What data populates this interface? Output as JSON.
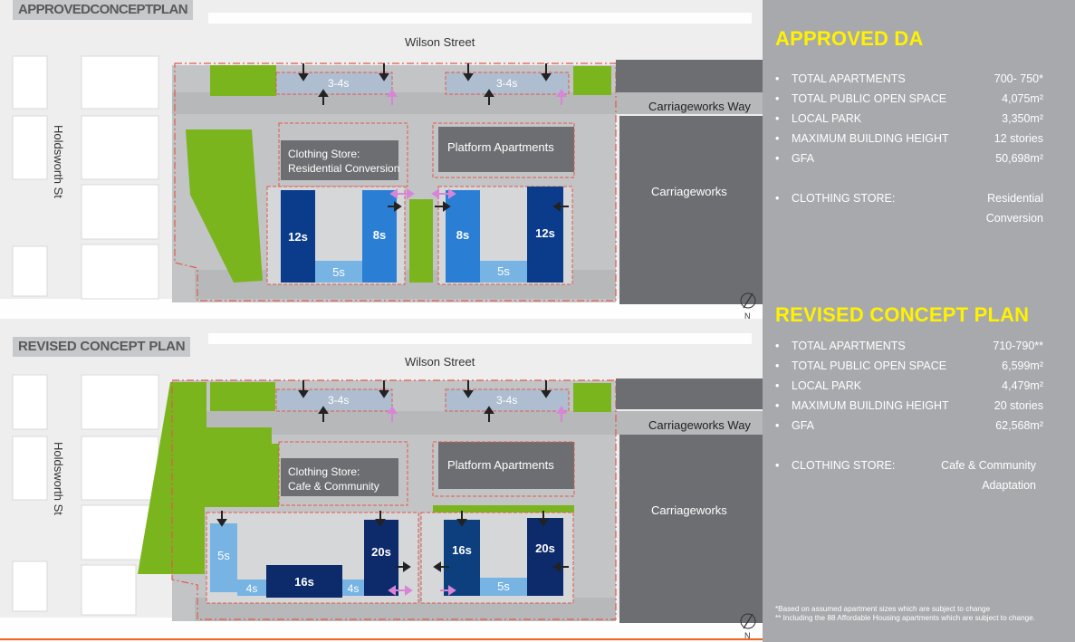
{
  "top_plan": {
    "header": "APPROVEDCONCEPTPLAN",
    "streets": {
      "north": "Wilson Street",
      "west": "Holdsworth St",
      "east_road": "Carriageworks Way",
      "east_block": "Carriageworks"
    },
    "labels": {
      "north_left": "3-4s",
      "north_right": "3-4s",
      "clothing_store_line1": "Clothing Store:",
      "clothing_store_line2": "Residential Conversion",
      "platform": "Platform Apartments",
      "b1": "12s",
      "b2": "5s",
      "b3": "8s",
      "b4": "8s",
      "b5": "5s",
      "b6": "12s"
    },
    "north_mark": "N"
  },
  "bottom_plan": {
    "header": "REVISED CONCEPT PLAN",
    "streets": {
      "north": "Wilson Street",
      "west": "Holdsworth St",
      "east_road": "Carriageworks Way",
      "east_block": "Carriageworks"
    },
    "labels": {
      "north_left": "3-4s",
      "north_right": "3-4s",
      "clothing_store_line1": "Clothing Store:",
      "clothing_store_line2": "Cafe & Community",
      "platform": "Platform Apartments",
      "b1": "5s",
      "b2": "4s",
      "b3": "16s",
      "b4": "4s",
      "b5": "20s",
      "b6": "16s",
      "b7": "5s",
      "b8": "20s"
    },
    "north_mark": "N"
  },
  "approved": {
    "title": "APPROVED DA",
    "bullet": "•",
    "rows": [
      {
        "key": "TOTAL APARTMENTS",
        "value": "700- 750*"
      },
      {
        "key": "TOTAL PUBLIC OPEN SPACE",
        "value": "4,075m²"
      },
      {
        "key": "LOCAL PARK",
        "value": "3,350m²"
      },
      {
        "key": "MAXIMUM BUILDING HEIGHT",
        "value": "12 stories"
      },
      {
        "key": "GFA",
        "value": "50,698m²"
      }
    ],
    "clothing_key": "CLOTHING STORE:",
    "clothing_value_1": "Residential",
    "clothing_value_2": "Conversion"
  },
  "revised": {
    "title": "REVISED CONCEPT PLAN",
    "bullet": "•",
    "rows": [
      {
        "key": "TOTAL APARTMENTS",
        "value": "710-790**"
      },
      {
        "key": "TOTAL PUBLIC OPEN SPACE",
        "value": "6,599m²"
      },
      {
        "key": "LOCAL PARK",
        "value": "4,479m²"
      },
      {
        "key": "MAXIMUM BUILDING HEIGHT",
        "value": "20 stories"
      },
      {
        "key": "GFA",
        "value": "62,568m²"
      }
    ],
    "clothing_key": "CLOTHING STORE:",
    "clothing_value_1": "Cafe & Community",
    "clothing_value_2": "Adaptation"
  },
  "footnotes": {
    "f1": "*Based on assumed apartment sizes which are subject to change",
    "f2": "** Including the 88 Affordable Housing apartments which are subject to change."
  },
  "colors": {
    "green": "#7ab51d",
    "dark_blue": "#0b3c8c",
    "mid_blue": "#2a7fd4",
    "light_blue": "#77b3e3",
    "navy": "#0d2a6b",
    "gray_block": "#6d6e71",
    "panel": "#a7a9ac",
    "accent": "#fff200"
  }
}
